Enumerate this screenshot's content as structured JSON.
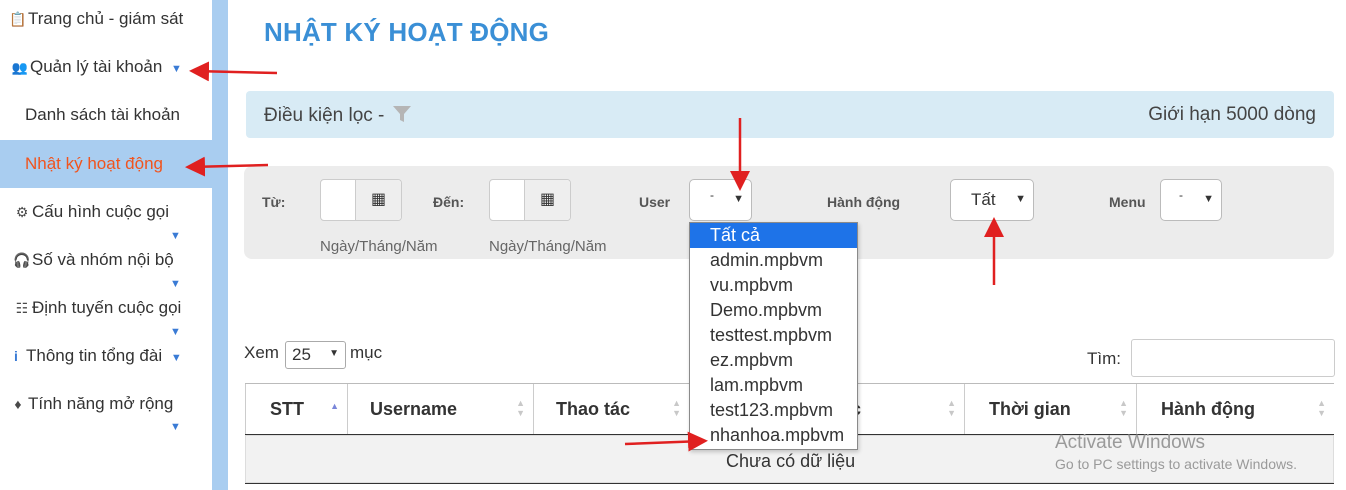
{
  "sidebar": {
    "items": [
      {
        "label": "Trang chủ - giám sát",
        "icon": "clipboard-icon"
      },
      {
        "label": "Quản lý tài khoản",
        "icon": "users-icon"
      },
      {
        "label": "Danh sách tài khoản",
        "icon": ""
      },
      {
        "label": "Nhật ký hoạt động",
        "icon": ""
      },
      {
        "label": "Cấu hình cuộc gọi",
        "icon": "cogs-icon"
      },
      {
        "label": "Số và nhóm nội bộ",
        "icon": "headset-icon"
      },
      {
        "label": "Định tuyến cuộc gọi",
        "icon": "sitemap-icon"
      },
      {
        "label": "Thông tin tổng đài",
        "icon": "info-icon"
      },
      {
        "label": "Tính năng mở rộng",
        "icon": "puzzle-icon"
      }
    ],
    "active_color": "#f0541e",
    "accent": "#a9cdf0"
  },
  "page": {
    "title": "NHẬT KÝ HOẠT ĐỘNG",
    "title_color": "#3a8fd6"
  },
  "filter_bar": {
    "label": "Điều kiện lọc -",
    "limit": "Giới hạn 5000 dòng"
  },
  "filters": {
    "from_label": "Từ:",
    "to_label": "Đến:",
    "date_hint": "Ngày/Tháng/Năm",
    "user_label": "User",
    "user_value": "-",
    "action_label": "Hành động",
    "action_value": "Tất",
    "menu_label": "Menu",
    "menu_value": "-"
  },
  "user_dropdown": {
    "options": [
      "Tất cả",
      "admin.mpbvm",
      "vu.mpbvm",
      "Demo.mpbvm",
      "testtest.mpbvm",
      "ez.mpbvm",
      "lam.mpbvm",
      "test123.mpbvm",
      "nhanhoa.mpbvm"
    ],
    "selected": "Tất cả"
  },
  "table_controls": {
    "show_label": "Xem",
    "page_length": "25",
    "entries_label": "mục",
    "search_label": "Tìm:"
  },
  "table": {
    "columns": [
      "STT",
      "Username",
      "Thao tác",
      "c",
      "Thời gian",
      "Hành động"
    ],
    "empty_text": "Chưa có dữ liệu"
  },
  "watermark": {
    "line1": "Activate Windows",
    "line2": "Go to PC settings to activate Windows."
  },
  "annotation_color": "#e02020"
}
